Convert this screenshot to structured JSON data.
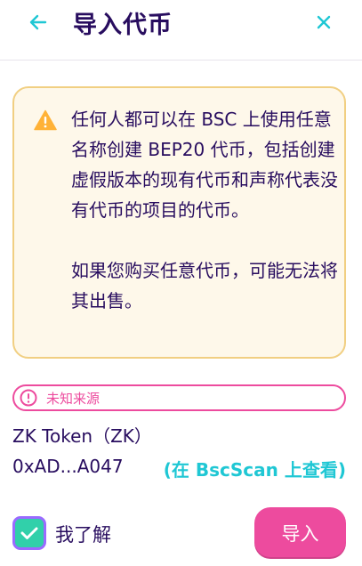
{
  "header": {
    "title": "导入代币",
    "back_icon": "arrow-left-icon",
    "close_icon": "close-icon"
  },
  "warning": {
    "icon": "warning-triangle-icon",
    "paragraph1": "任何人都可以在 BSC 上使用任意名称创建 BEP20 代币，包括创建虚假版本的现有代币和声称代表没有代币的项目的代币。",
    "paragraph2": "如果您购买任意代币，可能无法将其出售。"
  },
  "source_badge": {
    "icon": "alert-circle-icon",
    "label": "未知来源"
  },
  "token": {
    "name": "ZK Token（ZK）",
    "address": "0xAD...A047",
    "bscscan_link": "(在 BscScan 上查看)"
  },
  "acknowledge": {
    "checked": true,
    "label": "我了解"
  },
  "import_button": {
    "label": "导入"
  },
  "colors": {
    "primary_text": "#280d5f",
    "accent": "#1fc7d4",
    "pink": "#ed4b9e",
    "warning_bg": "#fef8ea",
    "warning_border": "#f1cf82",
    "warning_icon": "#ffb237",
    "check_green": "#31d0aa",
    "check_border": "#9a6aff"
  }
}
